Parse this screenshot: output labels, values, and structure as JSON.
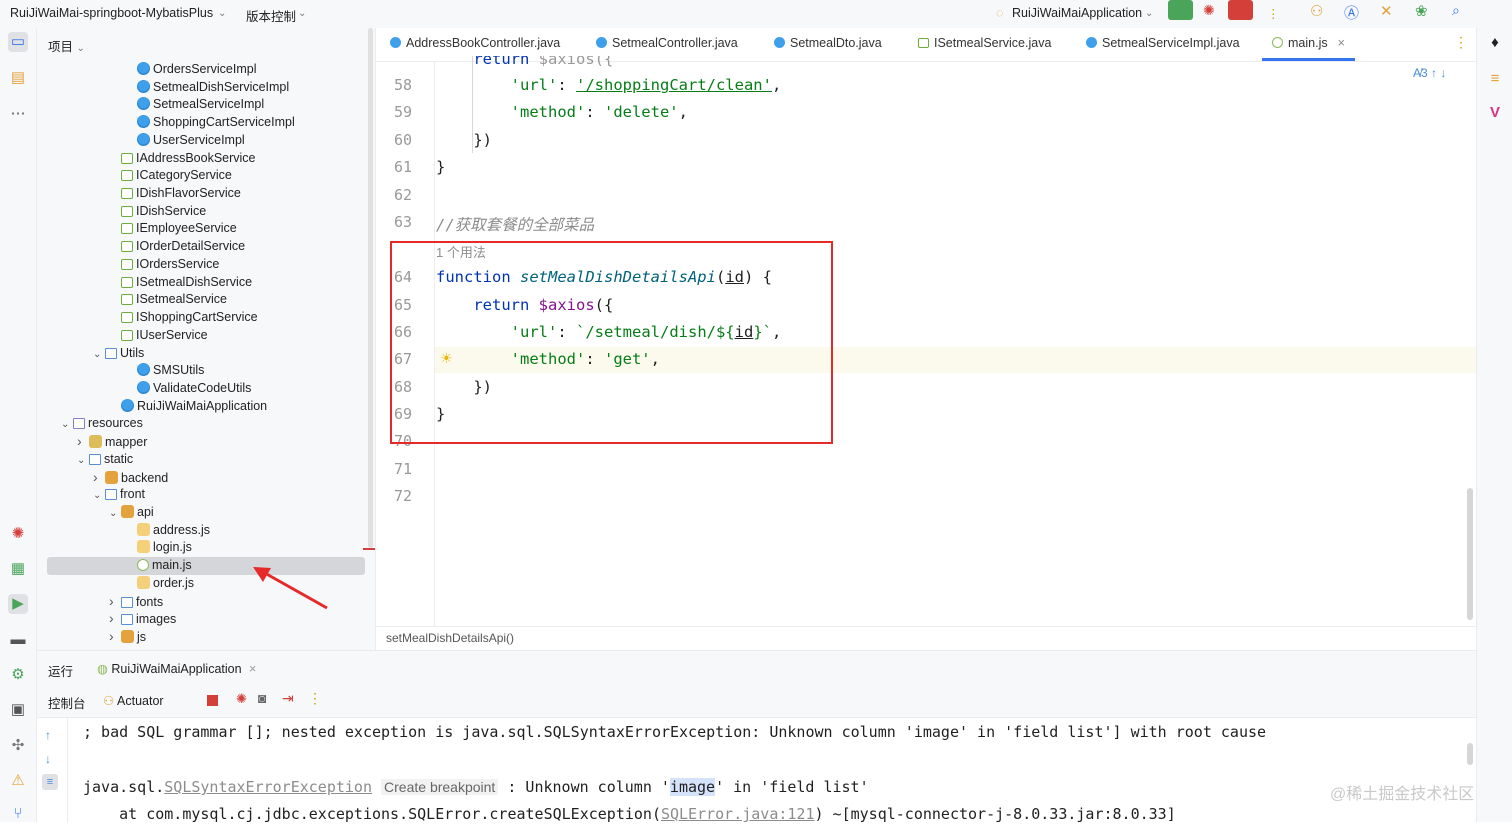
{
  "titlebar": {
    "project": "RuiJiWaiMai-springboot-MybatisPlus",
    "vcs": "版本控制",
    "run_config": "RuiJiWaiMaiApplication"
  },
  "project_panel": {
    "title": "项目",
    "tree": [
      {
        "label": "OrdersServiceImpl",
        "type": "class",
        "indent": 5
      },
      {
        "label": "SetmealDishServiceImpl",
        "type": "class",
        "indent": 5
      },
      {
        "label": "SetmealServiceImpl",
        "type": "class",
        "indent": 5
      },
      {
        "label": "ShoppingCartServiceImpl",
        "type": "class",
        "indent": 5
      },
      {
        "label": "UserServiceImpl",
        "type": "class",
        "indent": 5
      },
      {
        "label": "IAddressBookService",
        "type": "iface",
        "indent": 4
      },
      {
        "label": "ICategoryService",
        "type": "iface",
        "indent": 4
      },
      {
        "label": "IDishFlavorService",
        "type": "iface",
        "indent": 4
      },
      {
        "label": "IDishService",
        "type": "iface",
        "indent": 4
      },
      {
        "label": "IEmployeeService",
        "type": "iface",
        "indent": 4
      },
      {
        "label": "IOrderDetailService",
        "type": "iface",
        "indent": 4
      },
      {
        "label": "IOrdersService",
        "type": "iface",
        "indent": 4
      },
      {
        "label": "ISetmealDishService",
        "type": "iface",
        "indent": 4
      },
      {
        "label": "ISetmealService",
        "type": "iface",
        "indent": 4
      },
      {
        "label": "IShoppingCartService",
        "type": "iface",
        "indent": 4
      },
      {
        "label": "IUserService",
        "type": "iface",
        "indent": 4
      },
      {
        "label": "Utils",
        "type": "folder-blue",
        "indent": 3,
        "arrow": "down"
      },
      {
        "label": "SMSUtils",
        "type": "class",
        "indent": 5
      },
      {
        "label": "ValidateCodeUtils",
        "type": "class",
        "indent": 5
      },
      {
        "label": "RuiJiWaiMaiApplication",
        "type": "class",
        "indent": 4
      },
      {
        "label": "resources",
        "type": "folder-res",
        "indent": 1,
        "arrow": "down"
      },
      {
        "label": "mapper",
        "type": "folder",
        "indent": 2,
        "arrow": "right"
      },
      {
        "label": "static",
        "type": "folder-blue",
        "indent": 2,
        "arrow": "down"
      },
      {
        "label": "backend",
        "type": "folder-orange",
        "indent": 3,
        "arrow": "right"
      },
      {
        "label": "front",
        "type": "folder-blue",
        "indent": 3,
        "arrow": "down"
      },
      {
        "label": "api",
        "type": "folder-orange",
        "indent": 4,
        "arrow": "down"
      },
      {
        "label": "address.js",
        "type": "js",
        "indent": 5
      },
      {
        "label": "login.js",
        "type": "js",
        "indent": 5
      },
      {
        "label": "main.js",
        "type": "mainjs",
        "indent": 5,
        "selected": true
      },
      {
        "label": "order.js",
        "type": "js",
        "indent": 5
      },
      {
        "label": "fonts",
        "type": "folder-blue",
        "indent": 4,
        "arrow": "right"
      },
      {
        "label": "images",
        "type": "folder-blue",
        "indent": 4,
        "arrow": "right"
      },
      {
        "label": "js",
        "type": "folder-orange",
        "indent": 4,
        "arrow": "right"
      }
    ]
  },
  "editor": {
    "tabs": [
      {
        "label": "AddressBookController.java",
        "color": "#3ea0ea"
      },
      {
        "label": "SetmealController.java",
        "color": "#3ea0ea"
      },
      {
        "label": "SetmealDto.java",
        "color": "#3ea0ea"
      },
      {
        "label": "ISetmealService.java",
        "color": "#6cad3d"
      },
      {
        "label": "SetmealServiceImpl.java",
        "color": "#3ea0ea"
      },
      {
        "label": "main.js",
        "color": "#8bb85a",
        "active": true
      }
    ],
    "inspection_count": "3",
    "usage_hint": "1 个用法",
    "breadcrumb": "setMealDishDetailsApi()",
    "line_numbers": [
      "58",
      "59",
      "60",
      "61",
      "62",
      "63",
      "64",
      "65",
      "66",
      "67",
      "68",
      "69",
      "70",
      "71",
      "72"
    ],
    "code": {
      "l58_key": "'url'",
      "l58_val": "'/shoppingCart/clean'",
      "l59_key": "'method'",
      "l59_val": "'delete'",
      "l60": "})",
      "l61": "}",
      "l63": "//获取套餐的全部菜品",
      "l64_kw": "function",
      "l64_fn": "setMealDishDetailsApi",
      "l64_param": "id",
      "l65_kw": "return",
      "l65_call": "$axios",
      "l66_key": "'url'",
      "l66_val_a": "`/setmeal/dish/${",
      "l66_val_b": "id",
      "l66_val_c": "}`",
      "l67_key": "'method'",
      "l67_val": "'get'",
      "l68": "})",
      "l69": "}"
    }
  },
  "run_panel": {
    "title": "运行",
    "run_tab": "RuiJiWaiMaiApplication",
    "console_tab": "控制台",
    "actuator_tab": "Actuator",
    "line1": "; bad SQL grammar []; nested exception is java.sql.SQLSyntaxErrorException: Unknown column 'image' in 'field list'] with root cause",
    "line2_a": "java.sql.",
    "line2_link": "SQLSyntaxErrorException",
    "line2_hint": "Create breakpoint",
    "line2_b": " : Unknown column '",
    "line2_hl": "image",
    "line2_c": "' in 'field list'",
    "line3_a": "    at com.mysql.cj.jdbc.exceptions.SQLError.createSQLException(",
    "line3_link": "SQLError.java:121",
    "line3_b": ") ~[mysql-connector-j-8.0.33.jar:8.0.33]"
  },
  "watermark": "@稀土掘金技术社区",
  "colors": {
    "accent": "#3574f0",
    "annotation_red": "#e62a2a",
    "keyword": "#0033b3",
    "string": "#067d17"
  }
}
